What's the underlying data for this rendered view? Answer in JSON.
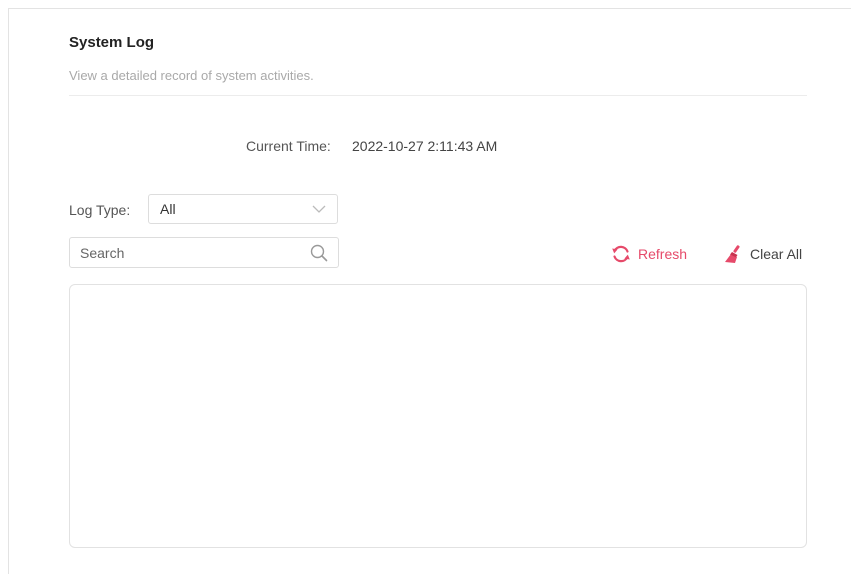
{
  "header": {
    "title": "System Log",
    "subtitle": "View a detailed record of system activities."
  },
  "current_time": {
    "label": "Current Time:",
    "value": "2022-10-27 2:11:43 AM"
  },
  "log_type": {
    "label": "Log Type:",
    "selected": "All"
  },
  "search": {
    "placeholder": "Search",
    "value": ""
  },
  "toolbar": {
    "refresh_label": "Refresh",
    "clear_all_label": "Clear All"
  },
  "log_entries": [],
  "colors": {
    "accent": "#e64a6a",
    "border": "#dddddd",
    "muted_text": "#a9a9a9"
  },
  "icons": {
    "select_arrow": "chevron-down-icon",
    "search": "search-icon",
    "refresh": "refresh-icon",
    "clear_all": "broom-icon"
  }
}
